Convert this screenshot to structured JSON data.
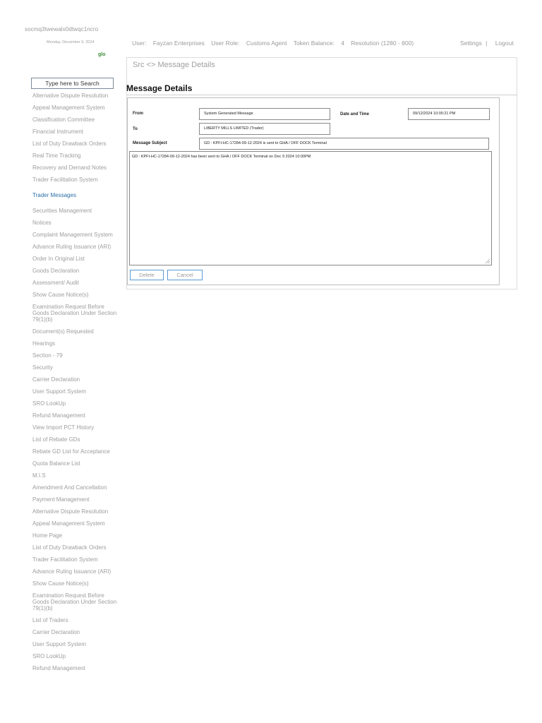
{
  "header": {
    "session_id": "socmq3twewalx0dtwqc1ncro",
    "date": "Monday, December 9, 2024",
    "logo_text": "glo"
  },
  "topbar": {
    "user_label": "User:",
    "user_value": "Fayzan Enterprises",
    "role_label": "User Role:",
    "role_value": "Customs Agent",
    "token_label": "Token Balance:",
    "token_value": "4",
    "resolution": "Resolution (1280 - 800)",
    "settings": "Settings",
    "separator": "|",
    "logout": "Logout"
  },
  "search": {
    "text": "Type here to Search"
  },
  "sidebar": {
    "items": [
      {
        "label": "Alternative Dispute Resolution"
      },
      {
        "label": "Appeal Management System"
      },
      {
        "label": "Classification Committee"
      },
      {
        "label": "Financial Instrument"
      },
      {
        "label": "List of Duty Drawback Orders"
      },
      {
        "label": "Real Time Tracking"
      },
      {
        "label": "Recovery and Demand Notes"
      },
      {
        "label": "Trader Facilitation System"
      },
      {
        "label": "Trader Messages",
        "active": true
      },
      {
        "label": "Securities Management"
      },
      {
        "label": "Notices"
      },
      {
        "label": "Complaint Management System"
      },
      {
        "label": "Advance Ruling Issuance (ARI)"
      },
      {
        "label": "Order In Original List"
      },
      {
        "label": "Goods Declaration"
      },
      {
        "label": "Assessment/ Audit"
      },
      {
        "label": "Show Cause Notice(s)"
      },
      {
        "label": "Examination Request Before Goods Declaration Under Section 79(1)(b)"
      },
      {
        "label": "Document(s) Requested"
      },
      {
        "label": "Hearings"
      },
      {
        "label": "Section - 79"
      },
      {
        "label": "Security"
      },
      {
        "label": "Carrier Declaration"
      },
      {
        "label": "User Support System"
      },
      {
        "label": "SRO LookUp"
      },
      {
        "label": "Refund Management"
      },
      {
        "label": "View Import PCT History"
      },
      {
        "label": "List of Rebate GDs"
      },
      {
        "label": "Rebate GD List for Acceptance"
      },
      {
        "label": "Quota Balance List"
      },
      {
        "label": "M.I.S"
      },
      {
        "label": "Amendment And Cancellation"
      },
      {
        "label": "Payment Management"
      },
      {
        "label": "Alternative Dispute Resolution"
      },
      {
        "label": "Appeal Management System"
      },
      {
        "label": "Home Page"
      },
      {
        "label": "List of Duty Drawback Orders"
      },
      {
        "label": "Trader Facilitation System"
      },
      {
        "label": "Advance Ruling Issuance (ARI)"
      },
      {
        "label": "Show Cause Notice(s)"
      },
      {
        "label": "Examination Request Before Goods Declaration Under Section 79(1)(b)"
      },
      {
        "label": "List of Traders"
      },
      {
        "label": "Carrier Declaration"
      },
      {
        "label": "User Support System"
      },
      {
        "label": "SRO LookUp"
      },
      {
        "label": "Refund Management"
      }
    ]
  },
  "main": {
    "breadcrumb": "Src <> Message Details",
    "title": "Message Details",
    "form": {
      "from_label": "From",
      "from_value": "System Generated Message",
      "datetime_label": "Date and Time",
      "datetime_value": "09/12/2024 10:00:21 PM",
      "to_label": "To",
      "to_value": "LIBERTY MILLS LIMITED (Trader)",
      "subject_label": "Message Subject",
      "subject_value": "GD : KPFI-HC-17284-09-12-2024 is sent to GHA / OFF DOCK Terminal",
      "body": "GD : KPFI-HC-17284-09-12-2024 has been sent to GHA / OFF DOCK Terminal on Dec  9 2024 10:00PM"
    },
    "buttons": {
      "delete": "Delete",
      "cancel": "Cancel"
    }
  }
}
